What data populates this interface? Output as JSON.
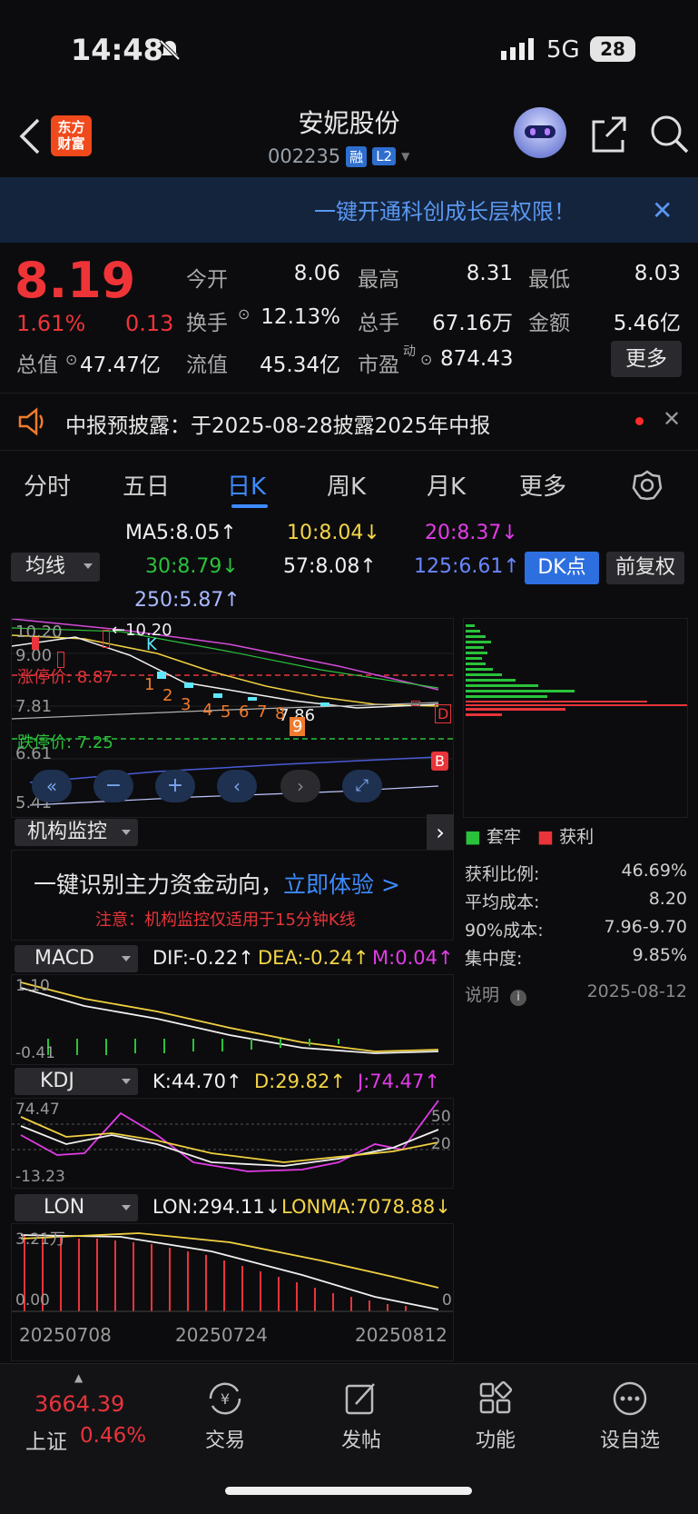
{
  "status": {
    "time": "14:48",
    "network": "5G",
    "battery": "28"
  },
  "header": {
    "logo": [
      "东方",
      "财富"
    ],
    "name": "安妮股份",
    "code": "002235",
    "tags": [
      "融",
      "L2"
    ]
  },
  "banner": {
    "text": "一键开通科创成长层权限！",
    "close": "✕"
  },
  "quote": {
    "price": "8.19",
    "pct": "1.61%",
    "change": "0.13",
    "fields": [
      {
        "label": "今开",
        "value": "8.06",
        "color": "#ededed"
      },
      {
        "label": "最高",
        "value": "8.31",
        "color": "#ef3438"
      },
      {
        "label": "最低",
        "value": "8.03",
        "color": "#2ac23b"
      },
      {
        "label": "换手",
        "value": "12.13%",
        "color": "#ededed"
      },
      {
        "label": "总手",
        "value": "67.16万",
        "color": "#ededed"
      },
      {
        "label": "金额",
        "value": "5.46亿",
        "color": "#ededed"
      },
      {
        "label": "总值",
        "value": "47.47亿",
        "color": "#ededed"
      },
      {
        "label": "流值",
        "value": "45.34亿",
        "color": "#ededed"
      },
      {
        "label": "市盈",
        "value": "874.43",
        "color": "#ededed"
      }
    ],
    "pe_sup": "动",
    "more": "更多"
  },
  "notice": {
    "text": "中报预披露：于2025-08-28披露2025年中报"
  },
  "tabs": [
    "分时",
    "五日",
    "日K",
    "周K",
    "月K",
    "更多"
  ],
  "ma": {
    "ma5": "MA5:8.05↑",
    "ma10": "10:8.04↓",
    "ma20": "20:8.37↓",
    "ma30": "30:8.79↓",
    "ma57": "57:8.08↑",
    "ma125": "125:6.61↑",
    "ma250": "250:5.87↑",
    "avg_btn": "均线",
    "dk_btn": "DK点",
    "fq_btn": "前复权"
  },
  "kline": {
    "price_labels": [
      "10.20",
      "9.00",
      "7.81",
      "6.61",
      "5.41"
    ],
    "high_note": "←10.20",
    "k_mark": "K",
    "low_note": "7.86",
    "limit_up": "涨停价: 8.87",
    "limit_down": "跌停价: 7.25",
    "seq_numbers": [
      "1",
      "2",
      "3",
      "4",
      "5",
      "6",
      "7",
      "8",
      "9"
    ],
    "dk_marks": [
      "D",
      "B"
    ]
  },
  "monitor": {
    "pill": "机构监控",
    "headline": "一键识别主力资金动向，",
    "cta": "立即体验 >",
    "note": "注意：机构监控仅适用于15分钟K线"
  },
  "chip": {
    "legend": [
      {
        "label": "套牢",
        "color": "#2ac23b"
      },
      {
        "label": "获利",
        "color": "#e8343a"
      }
    ],
    "rows": [
      {
        "label": "获利比例:",
        "value": "46.69%"
      },
      {
        "label": "平均成本:",
        "value": "8.20"
      },
      {
        "label": "90%成本:",
        "value": "7.96-9.70"
      },
      {
        "label": "集中度:",
        "value": "9.85%"
      }
    ],
    "explain": "说明",
    "date": "2025-08-12"
  },
  "macd": {
    "pill": "MACD",
    "dif": "DIF:-0.22↑",
    "dea": "DEA:-0.24↑",
    "m": "M:0.04↑",
    "top": "1.10",
    "bottom": "-0.41"
  },
  "kdj": {
    "pill": "KDJ",
    "k": "K:44.70↑",
    "d": "D:29.82↑",
    "j": "J:74.47↑",
    "top": "74.47",
    "bottom": "-13.23",
    "r50": "50",
    "r20": "20"
  },
  "lon": {
    "pill": "LON",
    "lon": "LON:294.11↓",
    "lonma": "LONMA:7078.88↓",
    "top": "3.21万",
    "bottom": "0.00",
    "r0": "0"
  },
  "xaxis": [
    "20250708",
    "20250724",
    "20250812"
  ],
  "bottom": {
    "index_value": "3664.39",
    "index_name": "上证",
    "index_pct": "0.46%",
    "items": [
      "交易",
      "发帖",
      "功能",
      "设自选"
    ]
  }
}
